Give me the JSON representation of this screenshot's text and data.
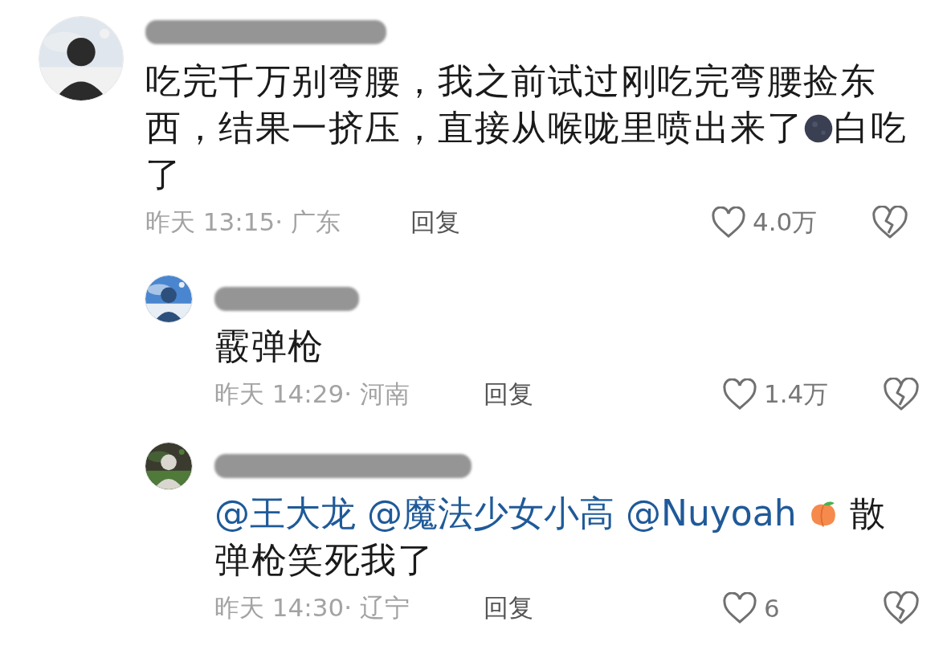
{
  "comments": [
    {
      "kind": "top",
      "body": [
        {
          "kind": "text",
          "text": "吃完千万别弯腰，我之前试过刚吃完弯腰捡东西，结果一挤压，直接从喉咙里喷出来了"
        },
        {
          "kind": "moon"
        },
        {
          "kind": "text",
          "text": "白吃了"
        }
      ],
      "meta": "昨天 13:15· 广东",
      "reply": "回复",
      "likes": "4.0万"
    },
    {
      "kind": "reply",
      "body": [
        {
          "kind": "text",
          "text": "霰弹枪"
        }
      ],
      "meta": "昨天 14:29· 河南",
      "reply": "回复",
      "likes": "1.4万"
    },
    {
      "kind": "reply",
      "body": [
        {
          "kind": "mention",
          "text": "@王大龙"
        },
        {
          "kind": "mention",
          "text": "@魔法少女小高"
        },
        {
          "kind": "mention",
          "text": "@Nuyoah"
        },
        {
          "kind": "peach"
        },
        {
          "kind": "text",
          "text": "散弹枪笑死我了"
        }
      ],
      "meta": "昨天 14:30· 辽宁",
      "reply": "回复",
      "likes": "6"
    }
  ]
}
